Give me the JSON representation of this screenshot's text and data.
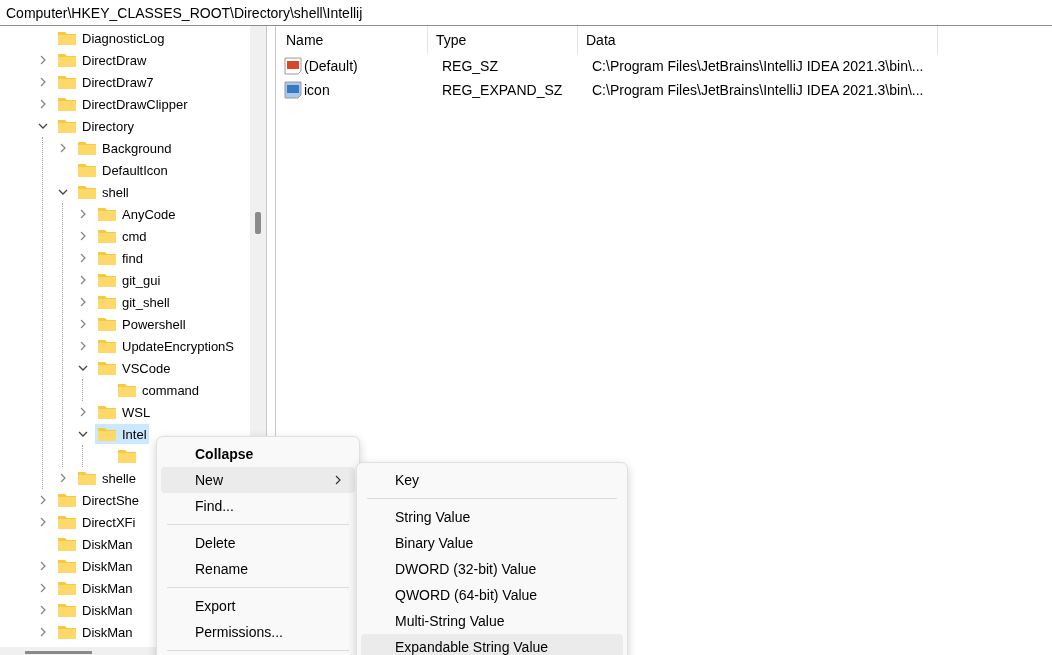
{
  "address_bar": {
    "path": "Computer\\HKEY_CLASSES_ROOT\\Directory\\shell\\Intellij"
  },
  "tree": {
    "items": [
      {
        "label": "DiagnosticLog",
        "selected": false
      },
      {
        "label": "DirectDraw",
        "expanded": false,
        "selected": false
      },
      {
        "label": "DirectDraw7",
        "expanded": false,
        "selected": false
      },
      {
        "label": "DirectDrawClipper",
        "expanded": false,
        "selected": false
      },
      {
        "label": "Directory",
        "expanded": true,
        "selected": false,
        "children": [
          {
            "label": "Background",
            "expanded": false,
            "selected": false
          },
          {
            "label": "DefaultIcon",
            "selected": false
          },
          {
            "label": "shell",
            "expanded": true,
            "selected": false,
            "children": [
              {
                "label": "AnyCode",
                "expanded": false,
                "selected": false
              },
              {
                "label": "cmd",
                "expanded": false,
                "selected": false
              },
              {
                "label": "find",
                "expanded": false,
                "selected": false
              },
              {
                "label": "git_gui",
                "expanded": false,
                "selected": false
              },
              {
                "label": "git_shell",
                "expanded": false,
                "selected": false
              },
              {
                "label": "Powershell",
                "expanded": false,
                "selected": false
              },
              {
                "label": "UpdateEncryptionS",
                "expanded": false,
                "selected": false
              },
              {
                "label": "VSCode",
                "expanded": true,
                "selected": false,
                "children": [
                  {
                    "label": "command",
                    "selected": false
                  }
                ]
              },
              {
                "label": "WSL",
                "expanded": false,
                "selected": false
              },
              {
                "label": "Intel",
                "expanded": true,
                "selected": true,
                "children": [
                  {
                    "selected": false
                  }
                ]
              }
            ]
          },
          {
            "label": "shelle",
            "expanded": false,
            "selected": false
          }
        ]
      },
      {
        "label": "DirectShe",
        "expanded": false,
        "selected": false
      },
      {
        "label": "DirectXFi",
        "expanded": false,
        "selected": false
      },
      {
        "label": "DiskMan",
        "selected": false
      },
      {
        "label": "DiskMan",
        "expanded": false,
        "selected": false
      },
      {
        "label": "DiskMan",
        "expanded": false,
        "selected": false
      },
      {
        "label": "DiskMan",
        "expanded": false,
        "selected": false
      },
      {
        "label": "DiskMan",
        "expanded": false,
        "selected": false
      }
    ]
  },
  "values": {
    "columns": [
      "Name",
      "Type",
      "Data"
    ],
    "rows": [
      {
        "kind": "string",
        "name": "(Default)",
        "type": "REG_SZ",
        "data": "C:\\Program Files\\JetBrains\\IntelliJ IDEA 2021.3\\bin\\..."
      },
      {
        "kind": "expand",
        "name": "icon",
        "type": "REG_EXPAND_SZ",
        "data": "C:\\Program Files\\JetBrains\\IntelliJ IDEA 2021.3\\bin\\..."
      }
    ]
  },
  "context_menu": {
    "items": [
      {
        "kind": "item",
        "label": "Collapse",
        "default": true,
        "selected": false
      },
      {
        "kind": "item",
        "label": "New",
        "submenu": true,
        "selected": true
      },
      {
        "kind": "item",
        "label": "Find...",
        "selected": false
      },
      {
        "kind": "separator"
      },
      {
        "kind": "item",
        "label": "Delete",
        "selected": false
      },
      {
        "kind": "item",
        "label": "Rename",
        "selected": false
      },
      {
        "kind": "separator"
      },
      {
        "kind": "item",
        "label": "Export",
        "selected": false
      },
      {
        "kind": "item",
        "label": "Permissions...",
        "selected": false
      },
      {
        "kind": "separator"
      }
    ]
  },
  "submenu": {
    "items": [
      {
        "kind": "item",
        "label": "Key",
        "selected": false
      },
      {
        "kind": "separator"
      },
      {
        "kind": "item",
        "label": "String Value",
        "selected": false
      },
      {
        "kind": "item",
        "label": "Binary Value",
        "selected": false
      },
      {
        "kind": "item",
        "label": "DWORD (32-bit) Value",
        "selected": false
      },
      {
        "kind": "item",
        "label": "QWORD (64-bit) Value",
        "selected": false
      },
      {
        "kind": "item",
        "label": "Multi-String Value",
        "selected": false
      },
      {
        "kind": "item",
        "label": "Expandable String Value",
        "selected": true
      }
    ]
  }
}
